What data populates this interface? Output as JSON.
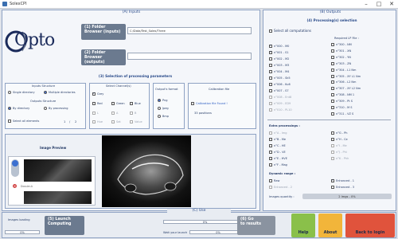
{
  "window": {
    "title": "SolexCPI"
  },
  "inputs": {
    "section_title": "(A) Inputs",
    "logo_text": "Opto",
    "folder_inputs_label": "(1) Folder\nBrowser (inputs)",
    "folder_inputs_path": "C:/Data/Test_Solex/Three",
    "folder_outputs_label": "(2) Folder\nBrowser (outputs)",
    "folder_outputs_path": "",
    "processing_title": "(3) Selection of processing parameters",
    "inputs_structure": {
      "title": "Inputs Structure",
      "single": "Single directory",
      "multiple": "Multiple directories"
    },
    "outputs_structure": {
      "title": "Outputs Structure",
      "by_directory": "By directory",
      "by_processing": "By processing"
    },
    "select_all": "Select all elements",
    "page_current": "1",
    "page_sep": "/",
    "page_total": "2",
    "channels": {
      "title": "Select Channel(s)",
      "grey": "Grey",
      "red": "Red",
      "green": "Green",
      "blue": "Blue",
      "l": "L",
      "a": "A",
      "b": "B",
      "hue": "Hue",
      "sat": "Sat",
      "value": "Value"
    },
    "format": {
      "title": "Output's format",
      "png": "Png",
      "jpeg": "Jpeg",
      "bmp": "Bmp"
    },
    "calibration": {
      "title": "Calibration file",
      "found": "Calibration file Found !",
      "positions": "33 positions"
    },
    "preview": {
      "title": "Image Preview",
      "thumb_label": "Dossier-A"
    }
  },
  "outputs": {
    "section_title": "(B) Outputs",
    "proc_title": "(4) Processing(s) selection",
    "select_all_comp": "Select all computations",
    "required_lp": "Required LP File :",
    "left_items": [
      {
        "label": "n°000 - M0",
        "checked": true,
        "disabled": false
      },
      {
        "label": "n°001 - S1",
        "checked": true,
        "disabled": false
      },
      {
        "label": "n°002 - M2",
        "checked": false,
        "disabled": false
      },
      {
        "label": "n°003 - M3",
        "checked": false,
        "disabled": false
      },
      {
        "label": "n°004 - M4",
        "checked": false,
        "disabled": false
      },
      {
        "label": "n°005 - Sk5",
        "checked": false,
        "disabled": false
      },
      {
        "label": "n°006 - Ku6",
        "checked": false,
        "disabled": false
      },
      {
        "label": "n°007 - S7",
        "checked": false,
        "disabled": false
      },
      {
        "label": "n°008 - Ent8",
        "checked": false,
        "disabled": true
      },
      {
        "label": "n°009 - ED9",
        "checked": false,
        "disabled": true
      },
      {
        "label": "n°010 - PL10",
        "checked": false,
        "disabled": true
      }
    ],
    "right_items": [
      {
        "label": "n°300 - NM",
        "checked": false,
        "disabled": false
      },
      {
        "label": "n°301 - XN",
        "checked": false,
        "disabled": false
      },
      {
        "label": "n°302 - YN",
        "checked": false,
        "disabled": false
      },
      {
        "label": "n°303 - ZN",
        "checked": false,
        "disabled": false
      },
      {
        "label": "n°304 - L1 Nm",
        "checked": false,
        "disabled": false
      },
      {
        "label": "n°305 - XY L1 Nm",
        "checked": false,
        "disabled": false
      },
      {
        "label": "n°306 - L2 Nm",
        "checked": false,
        "disabled": false
      },
      {
        "label": "n°307 - XY L2 Nm",
        "checked": false,
        "disabled": false
      },
      {
        "label": "n°308 - NM 1",
        "checked": false,
        "disabled": false
      },
      {
        "label": "n°309 - Pt S",
        "checked": false,
        "disabled": false
      },
      {
        "label": "n°310 - M S",
        "checked": false,
        "disabled": false
      },
      {
        "label": "n°311 - VZ S",
        "checked": false,
        "disabled": false
      }
    ],
    "extra_title": "Extra processings :",
    "extra_left": [
      {
        "label": "n°A - Img",
        "checked": false,
        "disabled": true
      },
      {
        "label": "n°B - Me",
        "checked": false,
        "disabled": false
      },
      {
        "label": "n°C - HE",
        "checked": false,
        "disabled": false
      },
      {
        "label": "n°D - VE",
        "checked": false,
        "disabled": false
      },
      {
        "label": "n°E - HVE",
        "checked": false,
        "disabled": false
      },
      {
        "label": "n°F - Mag",
        "checked": false,
        "disabled": false
      }
    ],
    "extra_right": [
      {
        "label": "n°G - Ph",
        "checked": false,
        "disabled": false
      },
      {
        "label": "n°H - Ce",
        "checked": false,
        "disabled": false
      },
      {
        "label": "n°I - Me",
        "checked": false,
        "disabled": true
      },
      {
        "label": "n°J - Phi",
        "checked": false,
        "disabled": true
      },
      {
        "label": "n°K - Phh",
        "checked": false,
        "disabled": true
      }
    ],
    "dynamic_title": "Dynamic range :",
    "dynamic": [
      {
        "label": "Raw",
        "checked": false,
        "disabled": false
      },
      {
        "label": "Enhanced - 1",
        "checked": true,
        "disabled": false
      },
      {
        "label": "Enhanced - 2",
        "checked": false,
        "disabled": true
      },
      {
        "label": "Enhanced - 3",
        "checked": false,
        "disabled": false
      }
    ],
    "quantity_label": "Images quantity :",
    "quantity_value": "2 Imgs - 0%"
  },
  "use": {
    "section_title": "(C) Use",
    "images_loading": "Images loading",
    "loading_pct": "0%",
    "launch": "(5) Launch\nComputing",
    "bar_pct": "0%",
    "wait_label": "Wait your launch",
    "wait_pct": "0%",
    "goto": "(6) Go\nto results",
    "help": "Help",
    "about": "About",
    "back": "Back to login"
  }
}
